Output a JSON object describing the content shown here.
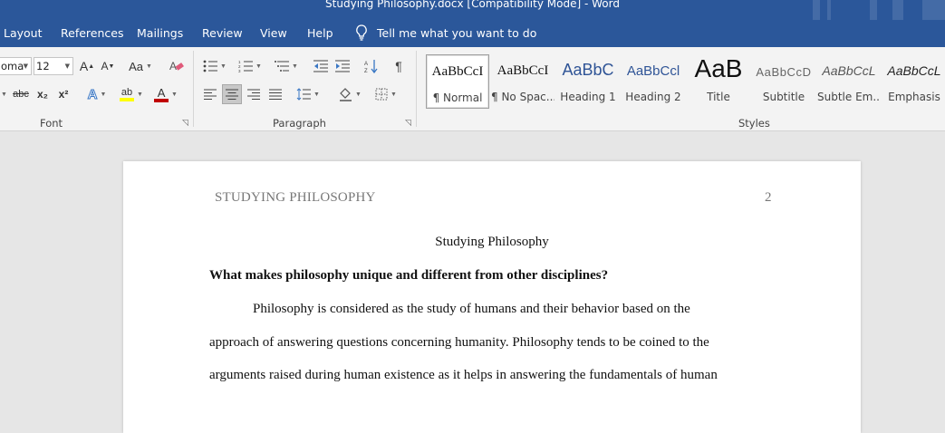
{
  "window": {
    "title": "Studying Philosophy.docx [Compatibility Mode]  -  Word"
  },
  "tabs": [
    "Layout",
    "References",
    "Mailings",
    "Review",
    "View",
    "Help"
  ],
  "tell_me": {
    "label": "Tell me what you want to do",
    "icon": "lightbulb-icon"
  },
  "ribbon": {
    "font": {
      "family_value": "oma",
      "size_value": "12",
      "label": "Font"
    },
    "paragraph": {
      "label": "Paragraph"
    },
    "styles": {
      "label": "Styles",
      "items": [
        {
          "sample": "AaBbCcI",
          "name": "¶ Normal",
          "selected": true
        },
        {
          "sample": "AaBbCcI",
          "name": "¶ No Spac..."
        },
        {
          "sample": "AaBbC",
          "name": "Heading 1"
        },
        {
          "sample": "AaBbCcl",
          "name": "Heading 2"
        },
        {
          "sample": "AaB",
          "name": "Title"
        },
        {
          "sample": "AaBbCcD",
          "name": "Subtitle"
        },
        {
          "sample": "AaBbCcL",
          "name": "Subtle Em..."
        },
        {
          "sample": "AaBbCcL",
          "name": "Emphasis"
        }
      ]
    },
    "font_symbols": {
      "grow": "A",
      "shrink": "A",
      "case": "Aa",
      "strike": "abc",
      "sub": "x₂",
      "sup": "x²",
      "effects": "A",
      "highlight": "ab",
      "color": "A"
    }
  },
  "colors": {
    "title_bar": "#2b579a",
    "highlight": "#ffff00",
    "font_color": "#c00000",
    "heading1": "#2f5496"
  },
  "document": {
    "header": "STUDYING PHILOSOPHY",
    "page_number": "2",
    "title": "Studying Philosophy",
    "heading": "What makes philosophy unique and different from other disciplines?",
    "lines": [
      "Philosophy is considered as the study of humans and their behavior based on the",
      "approach of answering questions concerning humanity. Philosophy tends to be coined to the",
      "arguments raised during human existence as it helps in answering the fundamentals of human"
    ]
  }
}
